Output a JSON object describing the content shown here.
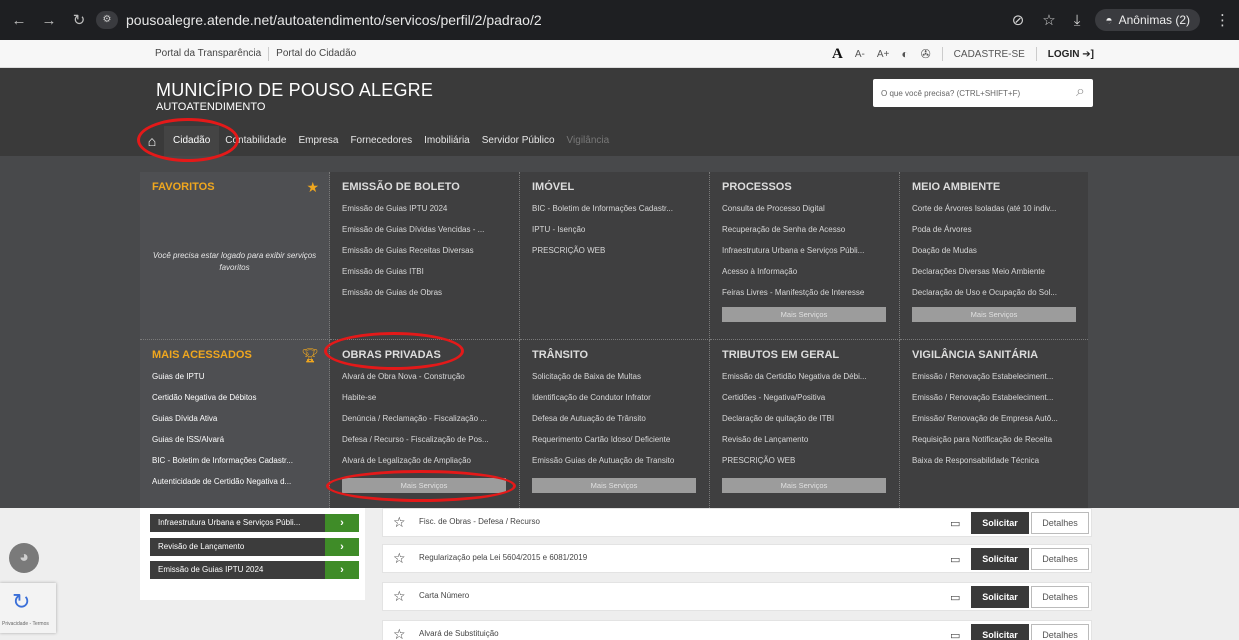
{
  "browser": {
    "url": "pousoalegre.atende.net/autoatendimento/servicos/perfil/2/padrao/2",
    "profile_label": "Anônimas (2)"
  },
  "topbar": {
    "links": [
      "Portal da Transparência",
      "Portal do Cidadão"
    ],
    "font_a": "A",
    "font_minus": "A-",
    "font_plus": "A+",
    "register": "CADASTRE-SE",
    "login": "LOGIN"
  },
  "header": {
    "title": "MUNICÍPIO DE POUSO ALEGRE",
    "subtitle": "AUTOATENDIMENTO",
    "search_placeholder": "O que você precisa? (CTRL+SHIFT+F)"
  },
  "nav_tabs": [
    "Cidadão",
    "Contabilidade",
    "Empresa",
    "Fornecedores",
    "Imobiliária",
    "Servidor Público",
    "Vigilância"
  ],
  "mega_menu": {
    "favoritos": {
      "title": "FAVORITOS",
      "message": "Você precisa estar logado para exibir serviços favoritos"
    },
    "emissao_boleto": {
      "title": "EMISSÃO DE BOLETO",
      "items": [
        "Emissão de Guias IPTU 2024",
        "Emissão de Guias Dívidas Vencidas - ...",
        "Emissão de Guias Receitas Diversas",
        "Emissão de Guias ITBI",
        "Emissão de Guias de Obras"
      ]
    },
    "imovel": {
      "title": "IMÓVEL",
      "items": [
        "BIC - Boletim de Informações Cadastr...",
        "IPTU - Isenção",
        "PRESCRIÇÃO WEB"
      ]
    },
    "processos": {
      "title": "PROCESSOS",
      "items": [
        "Consulta de Processo Digital",
        "Recuperação de Senha de Acesso",
        "Infraestrutura Urbana e Serviços Públi...",
        "Acesso à Informação",
        "Feiras Livres - Manifestção de Interesse"
      ],
      "more": "Mais Serviços"
    },
    "meio_ambiente": {
      "title": "MEIO AMBIENTE",
      "items": [
        "Corte de Árvores Isoladas (até 10 indiv...",
        "Poda de Árvores",
        "Doação de Mudas",
        "Declarações Diversas Meio Ambiente",
        "Declaração de Uso e Ocupação do Sol..."
      ],
      "more": "Mais Serviços"
    },
    "mais_acessados": {
      "title": "MAIS ACESSADOS",
      "items": [
        "Guias de IPTU",
        "Certidão Negativa de Débitos",
        "Guias Dívida Ativa",
        "Guias de ISS/Alvará",
        "BIC - Boletim de Informações Cadastr...",
        "Autenticidade de Certidão Negativa d..."
      ]
    },
    "obras_privadas": {
      "title": "OBRAS PRIVADAS",
      "items": [
        "Alvará de Obra Nova - Construção",
        "Habite-se",
        "Denúncia / Reclamação - Fiscalização ...",
        "Defesa / Recurso - Fiscalização de Pos...",
        "Alvará de Legalização de Ampliação"
      ],
      "more": "Mais Serviços"
    },
    "transito": {
      "title": "TRÂNSITO",
      "items": [
        "Solicitação de Baixa de Multas",
        "Identificação de Condutor Infrator",
        "Defesa de Autuação de Trânsito",
        "Requerimento Cartão Idoso/ Deficiente",
        "Emissão Guias de Autuação de Transito"
      ],
      "more": "Mais Serviços"
    },
    "tributos": {
      "title": "TRIBUTOS EM GERAL",
      "items": [
        "Emissão da Certidão Negativa de Débi...",
        "Certidões - Negativa/Positiva",
        "Declaração de quitação de ITBI",
        "Revisão de Lançamento",
        "PRESCRIÇÃO WEB"
      ],
      "more": "Mais Serviços"
    },
    "vigilancia": {
      "title": "VIGILÂNCIA SANITÁRIA",
      "items": [
        "Emissão / Renovação Estabeleciment...",
        "Emissão / Renovação Estabeleciment...",
        "Emissão/ Renovação de Empresa Autô...",
        "Requisição para Notificação de Receita",
        "Baixa de Responsabilidade Técnica"
      ]
    }
  },
  "left_buttons": [
    "Infraestrutura Urbana e Serviços Públi...",
    "Revisão de Lançamento",
    "Emissão de Guias IPTU 2024"
  ],
  "service_rows": [
    {
      "title": "Fisc. de Obras - Defesa / Recurso"
    },
    {
      "title": "Regularização pela Lei 5604/2015 e 6081/2019"
    },
    {
      "title": "Carta Número"
    },
    {
      "title": "Alvará de Substituição"
    }
  ],
  "row_actions": {
    "request": "Solicitar",
    "details": "Detalhes"
  },
  "recaptcha_label": "Privacidade - Termos",
  "colors": {
    "accent_orange": "#f0a71e",
    "header_dark": "#3a3a3a",
    "green": "#3f8c28",
    "annotation_red": "#e41919"
  }
}
